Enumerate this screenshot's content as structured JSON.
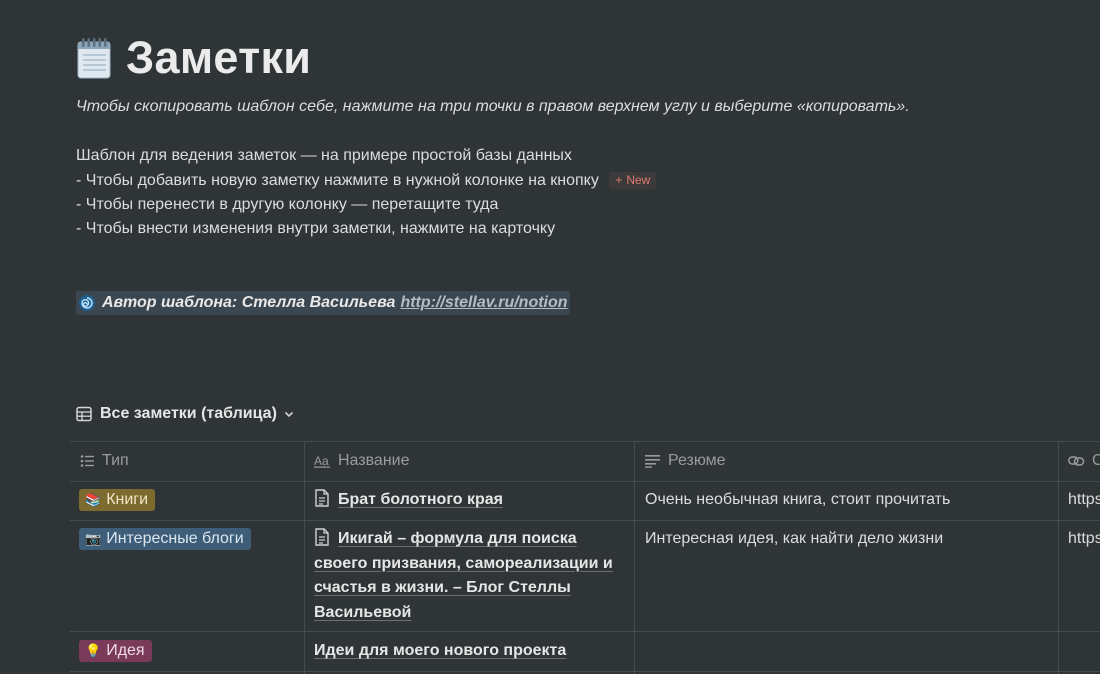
{
  "page": {
    "icon": "notepad-icon",
    "title": "Заметки",
    "subtitle": "Чтобы скопировать шаблон себе, нажмите на три точки в правом верхнем углу и выберите «копировать».",
    "intro": "Шаблон для ведения заметок — на примере простой базы данных",
    "bullets": [
      "- Чтобы добавить новую заметку нажмите в нужной колонке на кнопку",
      "- Чтобы перенести в другую колонку  — перетащите туда",
      "- Чтобы внести изменения внутри заметки, нажмите на карточку"
    ],
    "new_chip": {
      "plus": "+",
      "label": "New"
    },
    "author": {
      "icon": "swirl-icon",
      "text": "Автор шаблона: Стелла Васильева",
      "link": "http://stellav.ru/notion"
    }
  },
  "view": {
    "icon": "table-icon",
    "label": "Все заметки (таблица)",
    "chevron": "chevron-down-icon"
  },
  "table": {
    "columns": [
      {
        "icon": "list-icon",
        "label": "Тип"
      },
      {
        "icon": "text-icon",
        "label": "Название"
      },
      {
        "icon": "lines-icon",
        "label": "Резюме"
      },
      {
        "icon": "link-icon",
        "label": "С"
      }
    ],
    "rows": [
      {
        "tag": "Книги",
        "tag_icon": "books-emoji",
        "tag_color": "#7d6a2e",
        "name_lines": [
          "Брат болотного края"
        ],
        "has_doc_icon": true,
        "summary": "Очень необычная книга, стоит прочитать",
        "url": "https:"
      },
      {
        "tag": "Интересные блоги",
        "tag_icon": "camera-emoji",
        "tag_color": "#3d5d78",
        "name_lines": [
          "Икигай – формула для поиска",
          "своего призвания, самореализации и",
          "счастья в жизни. – Блог Стеллы",
          "Васильевой"
        ],
        "has_doc_icon": true,
        "summary": "Интересная идея, как найти дело жизни",
        "url": "https:"
      },
      {
        "tag": "Идея",
        "tag_icon": "bulb-emoji",
        "tag_color": "#7a3b5a",
        "name_lines": [
          "Идеи для моего нового проекта"
        ],
        "has_doc_icon": false,
        "summary": "",
        "url": ""
      }
    ]
  },
  "colors": {
    "background": "#2f3437",
    "new_text": "#e07a6e"
  }
}
